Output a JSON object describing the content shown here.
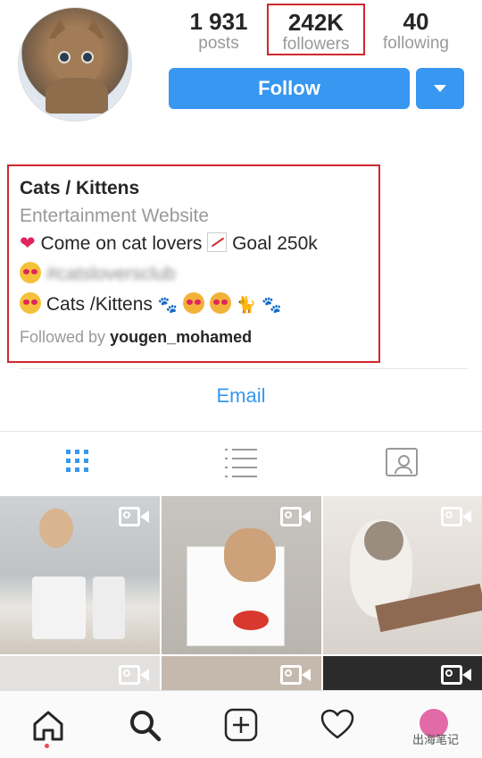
{
  "profile": {
    "stats": [
      {
        "value": "1 931",
        "label": "posts"
      },
      {
        "value": "242K",
        "label": "followers"
      },
      {
        "value": "40",
        "label": "following"
      }
    ],
    "follow_label": "Follow",
    "name": "Cats / Kittens",
    "category": "Entertainment Website",
    "bio_line1_a": "Come on cat lovers",
    "bio_line1_b": "Goal 250k",
    "bio_line2": "#catsloversclub",
    "bio_line3": "Cats /Kittens",
    "followed_by_prefix": "Followed by",
    "followed_by_user": "yougen_mohamed",
    "email_label": "Email"
  },
  "tabs": [
    "grid-icon",
    "list-icon",
    "tagged-icon"
  ],
  "nav": [
    "home-icon",
    "search-icon",
    "add-icon",
    "heart-icon",
    "profile-avatar"
  ],
  "colors": {
    "accent": "#3897f0",
    "highlight": "#d0282e"
  },
  "watermark": "出海笔记"
}
